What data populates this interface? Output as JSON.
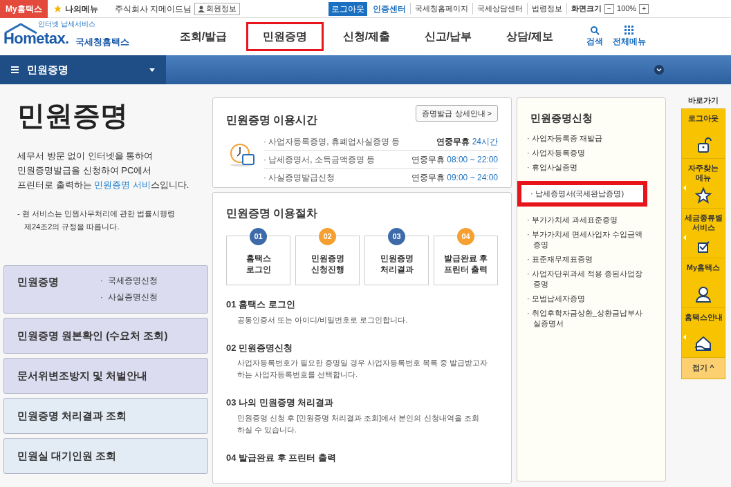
{
  "top_bar": {
    "my_hometax": "My홈택스",
    "my_menu": "나의메뉴",
    "user": "주식회사 지메이드님",
    "member_info": "회원정보",
    "logout": "로그아웃",
    "cert_center": "인증센터",
    "links": [
      "국세청홈페이지",
      "국세상담센터",
      "법령정보"
    ],
    "screen_size": "화면크기",
    "zoom_out": "−",
    "zoom": "100%",
    "zoom_in": "+"
  },
  "header": {
    "logo_small": "인터넷 납세서비스",
    "logo_main": "Hometax.",
    "logo_kr": "국세청홈택스",
    "nav": [
      {
        "label": "조회/발급",
        "highlighted": false
      },
      {
        "label": "민원증명",
        "highlighted": true
      },
      {
        "label": "신청/제출",
        "highlighted": false
      },
      {
        "label": "신고/납부",
        "highlighted": false
      },
      {
        "label": "상담/제보",
        "highlighted": false
      }
    ],
    "search": "검색",
    "all_menu": "전체메뉴"
  },
  "breadcrumb": {
    "label": "민원증명"
  },
  "intro": {
    "title": "민원증명",
    "description": "세무서 방문 없이 인터넷을 통하여\n민원증명발급을 신청하여 PC에서\n프린터로 출력하는 **민원증명 서비**스입니다.",
    "note": "- 현 서비스는 민원사무처리에 관한 법률시행령\n제24조2의 규정을 따릅니다."
  },
  "side_menu": [
    {
      "label": "민원증명",
      "color": "#dcdcf0",
      "sub": [
        "·  국세증명신청",
        "·  사실증명신청"
      ]
    },
    {
      "label": "민원증명 원본확인 (수요처 조회)",
      "color": "#dcdcf0"
    },
    {
      "label": "문서위변조방지 및 처벌안내",
      "color": "#dcdcf0"
    },
    {
      "label": "민원증명 처리결과 조회",
      "color": "#e3ebf4"
    },
    {
      "label": "민원실 대기인원 조회",
      "color": "#e3ebf4"
    }
  ],
  "hours": {
    "title": "민원증명 이용시간",
    "detail_button": "증명발급 상세안내 >",
    "rows": [
      {
        "item": "· 사업자등록증명, 휴폐업사실증명 등",
        "prefix": "연중무휴",
        "time": "24시간",
        "bold": true
      },
      {
        "item": "· 납세증명서, 소득금액증명 등",
        "prefix": "연중무휴",
        "time": "08:00 ~ 22:00",
        "bold": false
      },
      {
        "item": "· 사실증명발급신청",
        "prefix": "연중무휴",
        "time": "09:00 ~ 24:00",
        "bold": false
      }
    ]
  },
  "procedure": {
    "title": "민원증명 이용절차",
    "steps": [
      {
        "num": "01",
        "label": "홈택스\n로그인",
        "color": "#3d6aa8"
      },
      {
        "num": "02",
        "label": "민원증명\n신청진행",
        "color": "#f5a030"
      },
      {
        "num": "03",
        "label": "민원증명\n처리결과",
        "color": "#3d6aa8"
      },
      {
        "num": "04",
        "label": "발급완료 후\n프린터 출력",
        "color": "#f5a030"
      }
    ],
    "details": [
      {
        "heading": "01 홈택스 로그인",
        "text": "공동인증서 또는 아이디/비밀번호로 로그인합니다."
      },
      {
        "heading": "02 민원증명신청",
        "text": "사업자등록번호가 필요한 증명일 경우 사업자등록번호 목록 중 발급받고자\n하는 사업자등록번호를 선택합니다."
      },
      {
        "heading": "03 나의 민원증명 처리결과",
        "text": "민원증명 신청 후 [민원증명 처리결과 조회]에서 본인의 신청내역을 조회\n하실 수 있습니다."
      },
      {
        "heading": "04 발급완료 후 프린터 출력"
      }
    ]
  },
  "apply": {
    "title": "민원증명신청",
    "items": [
      {
        "label": "· 사업자등록증 재발급",
        "highlighted": false
      },
      {
        "label": "· 사업자등록증명",
        "highlighted": false
      },
      {
        "label": "· 휴업사실증명",
        "highlighted": false
      },
      {
        "label": "· 납세증명서(국세완납증명)",
        "highlighted": true
      },
      {
        "label": "· 부가가치세 과세표준증명",
        "highlighted": false
      },
      {
        "label": "· 부가가치세 면세사업자 수입금액\n증명",
        "highlighted": false
      },
      {
        "label": "· 표준재무제표증명",
        "highlighted": false
      },
      {
        "label": "· 사업자단위과세 적용 종된사업장\n증명",
        "highlighted": false
      },
      {
        "label": "· 모범납세자증명",
        "highlighted": false
      },
      {
        "label": "· 취업후학자금상환_상환금납부사\n실증명서",
        "highlighted": false
      }
    ]
  },
  "quick": {
    "title": "바로가기",
    "items": [
      {
        "label": "로그아웃",
        "kind": "lock",
        "arrow": false
      },
      {
        "label": "자주찾는\n메뉴",
        "kind": "star",
        "arrow": true
      },
      {
        "label": "세금종류별\n서비스",
        "kind": "check",
        "arrow": true
      },
      {
        "label": "My홈택스",
        "kind": "person",
        "arrow": false
      },
      {
        "label": "홈택스안내",
        "kind": "house",
        "arrow": true
      }
    ],
    "collapse": "접기 ^"
  }
}
